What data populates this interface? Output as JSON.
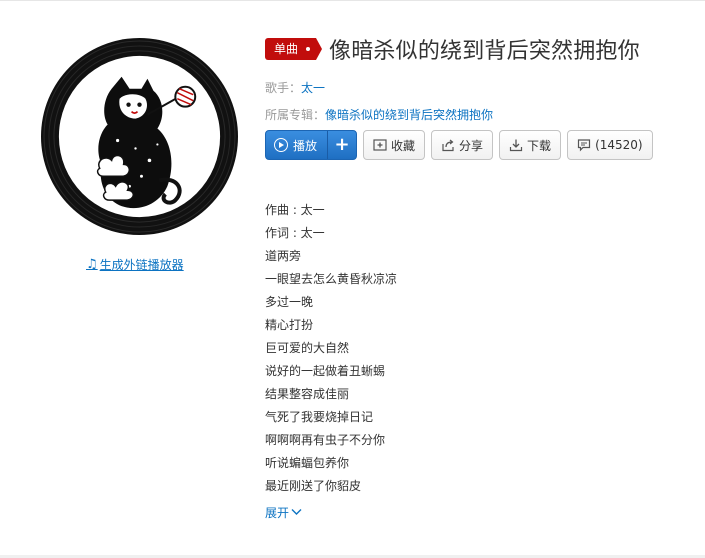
{
  "header": {
    "tag_label": "单曲",
    "title": "像暗杀似的绕到背后突然拥抱你"
  },
  "meta": {
    "singer_label": "歌手：",
    "singer": "太一",
    "album_label": "所属专辑：",
    "album": "像暗杀似的绕到背后突然拥抱你"
  },
  "buttons": {
    "play": "播放",
    "add": "+",
    "collect": "收藏",
    "share": "分享",
    "download": "下载",
    "comment": "(14520)"
  },
  "cover": {
    "external_player": "生成外链播放器"
  },
  "lyrics": {
    "lines": [
      "作曲 : 太一",
      "作词 : 太一",
      "道两旁",
      "一眼望去怎么黄昏秋凉凉",
      "多过一晚",
      "精心打扮",
      "巨可爱的大自然",
      "说好的一起做着丑蜥蜴",
      "结果整容成佳丽",
      "气死了我要烧掉日记",
      "啊啊啊再有虫子不分你",
      "听说蝙蝠包养你",
      "最近刚送了你貂皮"
    ],
    "expand": "展开"
  },
  "colors": {
    "accent_red": "#c10d0c",
    "link_blue": "#0c73c2",
    "play_blue": "#2b7fd4"
  },
  "icons": {
    "play": "play-circle-icon",
    "collect": "add-folder-icon",
    "share": "share-icon",
    "download": "download-icon",
    "comment": "comment-icon",
    "note": "music-note-icon",
    "expand": "chevron-down-icon"
  }
}
